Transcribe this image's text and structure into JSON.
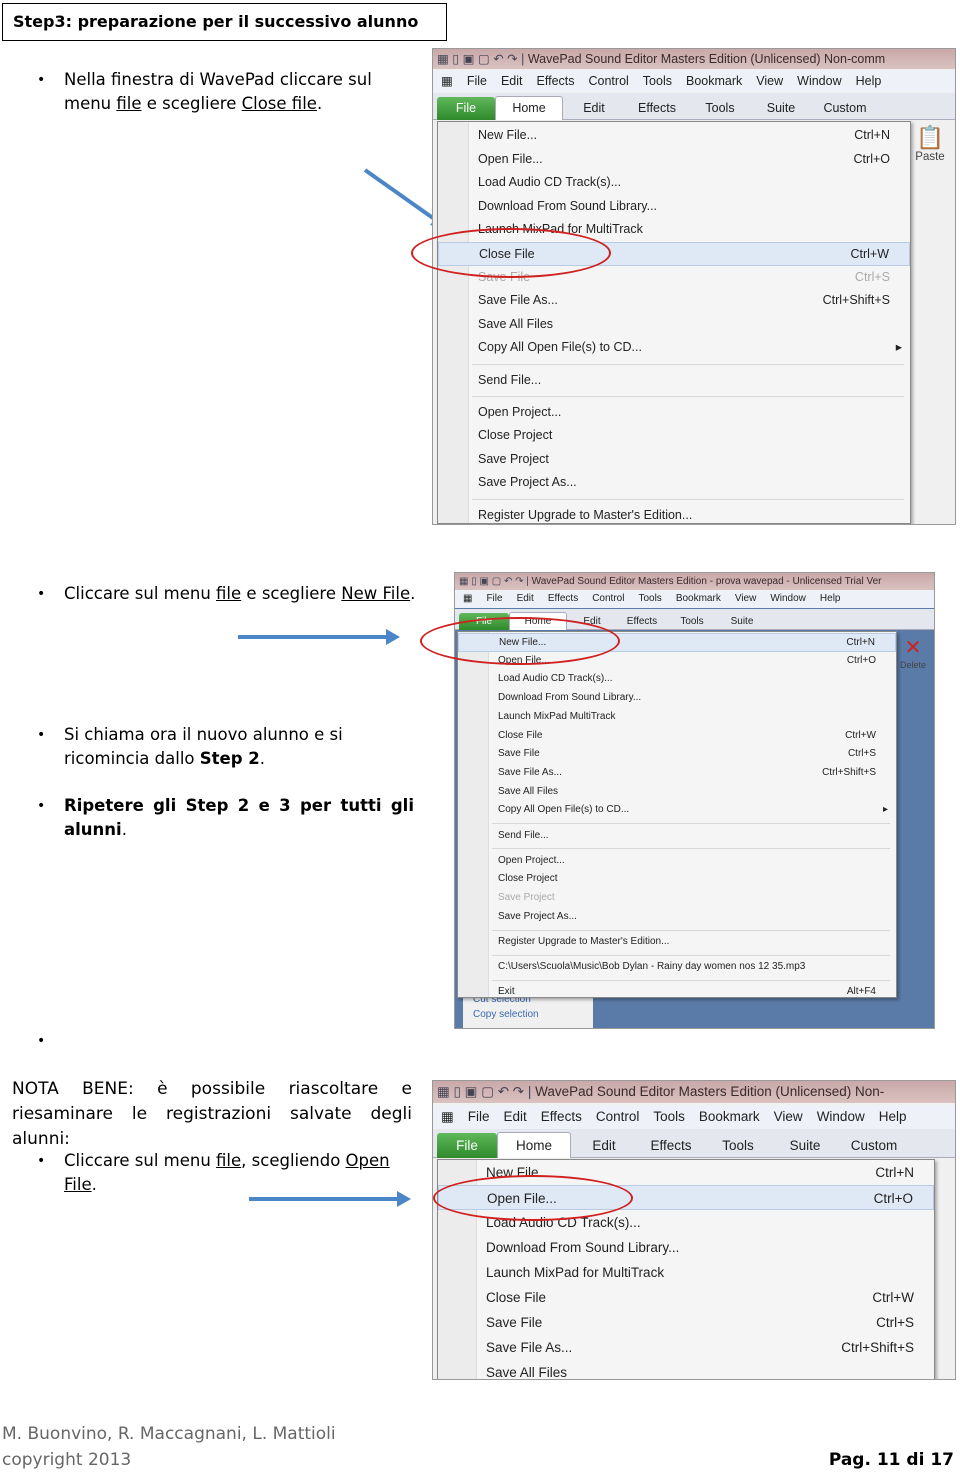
{
  "step_heading": "Step3: preparazione per il successivo alunno",
  "section1": {
    "t1": "Nella finestra di WavePad cliccare sul menu",
    "link1": "file",
    "t2": " e scegliere ",
    "link2": "Close file",
    "t3": "."
  },
  "section2": {
    "t1": "Cliccare sul menu ",
    "link1": "file",
    "t2": " e scegliere ",
    "link2": "New File",
    "t3": "."
  },
  "section3": {
    "t1": "Si chiama ora il nuovo alunno e si ricomincia dallo ",
    "b1": "Step 2",
    "t2": "."
  },
  "section4": {
    "b1": "Ripetere gli Step 2 e 3 per tutti gli alunni",
    "t1": "."
  },
  "nota": "NOTA BENE: è possibile riascoltare e riesaminare le registrazioni salvate degli alunni:",
  "section5": {
    "t1": "Cliccare sul menu ",
    "link1": "file",
    "t2": ", scegliendo ",
    "link2": "Open File",
    "t3": "."
  },
  "bullet_glyph": "•",
  "footer": {
    "authors": "M. Buonvino, R. Maccagnani, L. Mattioli",
    "copyright": "copyright 2013",
    "page": "Pag. 11 di 17"
  },
  "colors": {
    "highlight_ellipse": "#d02020",
    "arrow": "#4a86c8",
    "file_tab": "#3a9a36"
  },
  "screenshots": [
    {
      "title": "WavePad Sound Editor Masters Edition (Unlicensed) Non-comm",
      "menubar": [
        "File",
        "Edit",
        "Effects",
        "Control",
        "Tools",
        "Bookmark",
        "View",
        "Window",
        "Help"
      ],
      "ribbon": [
        "File",
        "Home",
        "Edit",
        "Effects",
        "Tools",
        "Suite",
        "Custom"
      ],
      "side_button": "Paste",
      "items": [
        {
          "label": "New File...",
          "shortcut": "Ctrl+N"
        },
        {
          "label": "Open File...",
          "shortcut": "Ctrl+O"
        },
        {
          "label": "Load Audio CD Track(s)..."
        },
        {
          "label": "Download From Sound Library..."
        },
        {
          "label": "Launch MixPad for MultiTrack"
        },
        {
          "label": "Close File",
          "shortcut": "Ctrl+W",
          "state": "hl"
        },
        {
          "label": "Save File",
          "shortcut": "Ctrl+S",
          "state": "dis"
        },
        {
          "label": "Save File As...",
          "shortcut": "Ctrl+Shift+S"
        },
        {
          "label": "Save All Files"
        },
        {
          "label": "Copy All Open File(s) to CD...",
          "submenu": "▸"
        },
        {
          "sep": true
        },
        {
          "label": "Send File..."
        },
        {
          "sep": true
        },
        {
          "label": "Open Project..."
        },
        {
          "label": "Close Project"
        },
        {
          "label": "Save Project"
        },
        {
          "label": "Save Project As..."
        },
        {
          "sep": true
        },
        {
          "label": "Register Upgrade to Master's Edition..."
        }
      ]
    },
    {
      "title": "WavePad Sound Editor Masters Edition - prova wavepad - Unlicensed Trial Ver",
      "menubar": [
        "File",
        "Edit",
        "Effects",
        "Control",
        "Tools",
        "Bookmark",
        "View",
        "Window",
        "Help"
      ],
      "ribbon": [
        "File",
        "Home",
        "Edit",
        "Effects",
        "Tools",
        "Suite"
      ],
      "side_button": "Delete",
      "bottom_links": [
        "Cut selection",
        "Copy selection"
      ],
      "items": [
        {
          "label": "New File...",
          "shortcut": "Ctrl+N",
          "state": "hl"
        },
        {
          "label": "Open File...",
          "shortcut": "Ctrl+O"
        },
        {
          "label": "Load Audio CD Track(s)..."
        },
        {
          "label": "Download From Sound Library..."
        },
        {
          "label": "Launch MixPad MultiTrack"
        },
        {
          "label": "Close File",
          "shortcut": "Ctrl+W"
        },
        {
          "label": "Save File",
          "shortcut": "Ctrl+S"
        },
        {
          "label": "Save File As...",
          "shortcut": "Ctrl+Shift+S"
        },
        {
          "label": "Save All Files"
        },
        {
          "label": "Copy All Open File(s) to CD...",
          "submenu": "▸"
        },
        {
          "sep": true
        },
        {
          "label": "Send File..."
        },
        {
          "sep": true
        },
        {
          "label": "Open Project..."
        },
        {
          "label": "Close Project"
        },
        {
          "label": "Save Project",
          "state": "dis"
        },
        {
          "label": "Save Project As..."
        },
        {
          "sep": true
        },
        {
          "label": "Register Upgrade to Master's Edition..."
        },
        {
          "sep": true
        },
        {
          "label": "C:\\Users\\Scuola\\Music\\Bob Dylan - Rainy day women nos 12 35.mp3"
        },
        {
          "sep": true
        },
        {
          "label": "Exit",
          "shortcut": "Alt+F4"
        }
      ]
    },
    {
      "title": "WavePad Sound Editor Masters Edition (Unlicensed) Non-",
      "menubar": [
        "File",
        "Edit",
        "Effects",
        "Control",
        "Tools",
        "Bookmark",
        "View",
        "Window",
        "Help"
      ],
      "ribbon": [
        "File",
        "Home",
        "Edit",
        "Effects",
        "Tools",
        "Suite",
        "Custom"
      ],
      "items": [
        {
          "label": "New File...",
          "shortcut": "Ctrl+N"
        },
        {
          "label": "Open File...",
          "shortcut": "Ctrl+O",
          "state": "hl"
        },
        {
          "label": "Load Audio CD Track(s)..."
        },
        {
          "label": "Download From Sound Library..."
        },
        {
          "label": "Launch MixPad for MultiTrack"
        },
        {
          "label": "Close File",
          "shortcut": "Ctrl+W"
        },
        {
          "label": "Save File",
          "shortcut": "Ctrl+S"
        },
        {
          "label": "Save File As...",
          "shortcut": "Ctrl+Shift+S"
        },
        {
          "label": "Save All Files"
        }
      ]
    }
  ]
}
